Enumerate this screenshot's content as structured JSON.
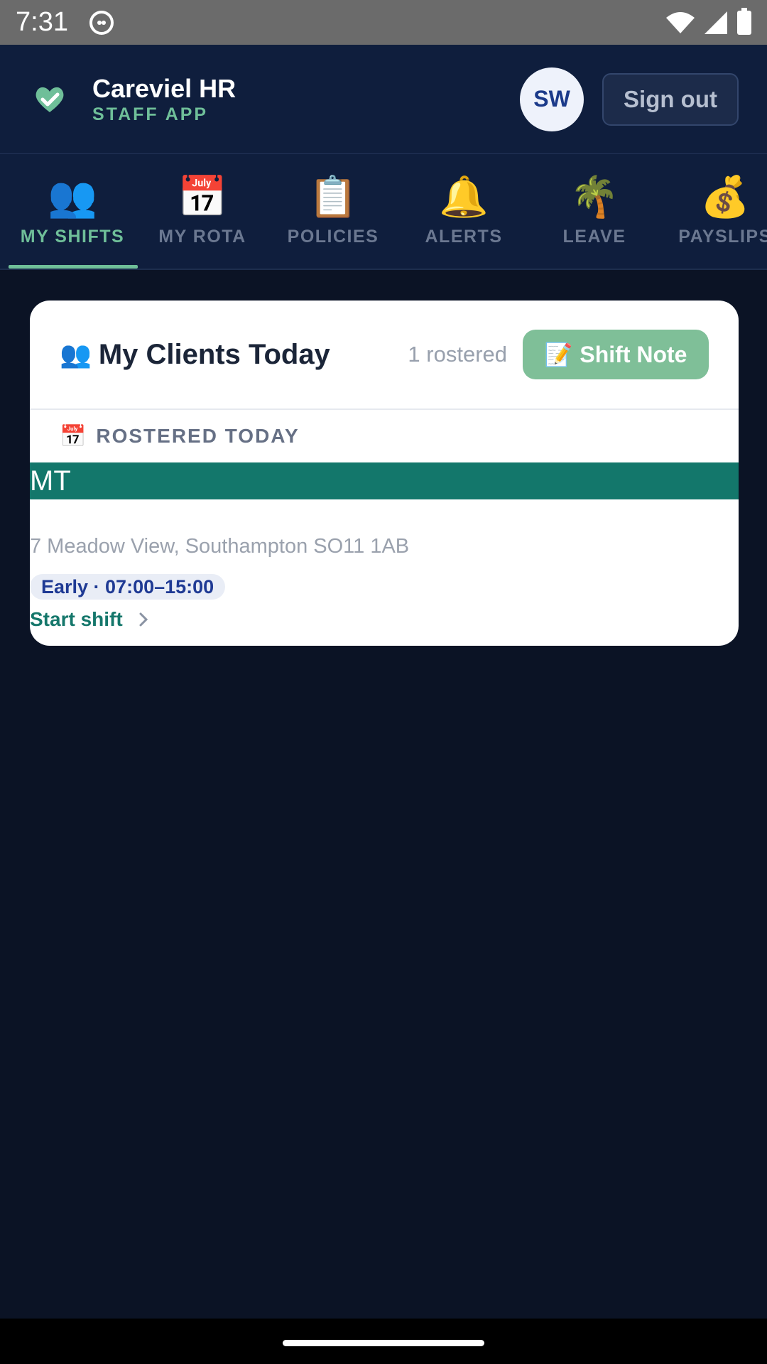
{
  "status_bar": {
    "time": "7:31"
  },
  "header": {
    "title": "Careviel HR",
    "subtitle": "STAFF APP",
    "avatar_initials": "SW",
    "signout_label": "Sign out"
  },
  "tabs": [
    {
      "icon": "👥",
      "icon_name": "people-icon",
      "label": "MY SHIFTS",
      "active": true
    },
    {
      "icon": "📅",
      "icon_name": "calendar-icon",
      "label": "MY ROTA",
      "active": false
    },
    {
      "icon": "📋",
      "icon_name": "clipboard-icon",
      "label": "POLICIES",
      "active": false
    },
    {
      "icon": "🔔",
      "icon_name": "bell-icon",
      "label": "ALERTS",
      "active": false
    },
    {
      "icon": "🌴",
      "icon_name": "palm-tree-icon",
      "label": "LEAVE",
      "active": false
    },
    {
      "icon": "💰",
      "icon_name": "money-bag-icon",
      "label": "PAYSLIPS",
      "active": false
    }
  ],
  "card": {
    "icon": "👥",
    "title": "My Clients Today",
    "count": "1 rostered",
    "note_button_icon": "📝",
    "note_button_label": "Shift Note",
    "section_icon": "📅",
    "section_label": "ROSTERED TODAY",
    "client": {
      "initials": "MT",
      "address": "7 Meadow View, Southampton SO11 1AB",
      "shift": "Early · 07:00–15:00",
      "action": "Start shift"
    }
  },
  "colors": {
    "header_bg": "#0f1e3d",
    "page_bg": "#0b1325",
    "accent_green": "#6fbf99",
    "client_bar": "#13776b",
    "shift_pill_text": "#1f3a94"
  }
}
